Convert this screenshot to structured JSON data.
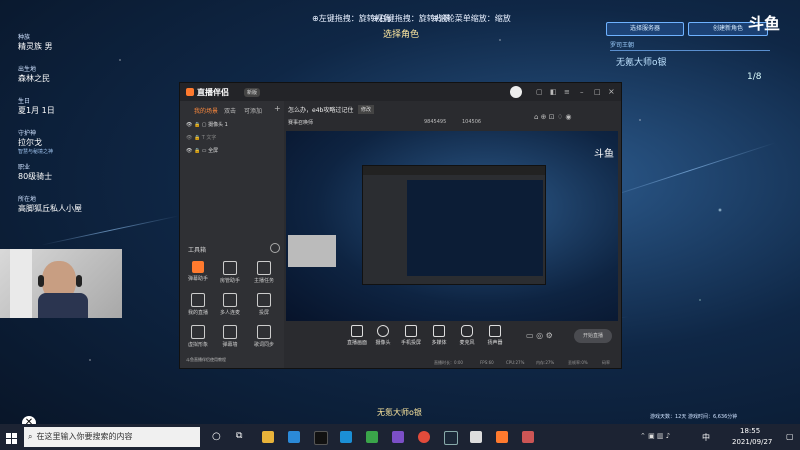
{
  "game": {
    "top_hints": [
      "⊕左键拖拽：旋转视角",
      "⊕右键拖拽：旋转背景",
      "⊕滚轮菜单缩放：缩放"
    ],
    "select_role": "选择角色",
    "left_panel": [
      {
        "label": "种族",
        "value": "精灵族 男"
      },
      {
        "label": "出生地",
        "value": "森林之民"
      },
      {
        "label": "生日",
        "value": "夏1月 1日"
      },
      {
        "label": "守护神",
        "value": "拉尔戈",
        "sub": "智慧与秘境之神"
      },
      {
        "label": "职业",
        "value": "80级骑士"
      },
      {
        "label": "所在地",
        "value": "高脚狐丘私人小屋"
      }
    ],
    "right_panel": {
      "btn_select_server": "选择服务器",
      "btn_create_role": "创建新角色",
      "server_label": "罗司王朝",
      "character_name": "无氪大师o银",
      "page": "1/8"
    },
    "bottom_name": "无氪大师o银",
    "playtime": "游戏天数：12天  游戏时间：6,636分钟"
  },
  "window": {
    "app_name": "直播伴侣",
    "version_badge": "新版",
    "sidebar_tabs": [
      "我的场景",
      "双击",
      "可添加",
      "+"
    ],
    "scene_items": [
      "摄像头 1",
      "文字",
      "全屏"
    ],
    "toolbox_label": "工具箱",
    "tools": [
      "弹幕助手",
      "房管助手",
      "主播任务",
      "我的直播",
      "多人连麦",
      "投屏",
      "虚拟形象",
      "弹幕墙",
      "歌词同步",
      "斗鱼直播伴侣使用教程"
    ],
    "stream_title": "怎么办，e4b攻略过记住",
    "edit_btn": "修改",
    "category": "赛事召唤师",
    "uid": "9845495",
    "heat": "104506",
    "controls": [
      "直播画面",
      "摄像头",
      "手机投屏",
      "多媒体",
      "麦克风",
      "扬声器"
    ],
    "start_btn": "开始直播",
    "status_items": [
      "直播时长：0:00",
      "FPS:60",
      "CPU:27%",
      "内存:27%",
      "丢帧率:0%",
      "码率"
    ]
  },
  "taskbar": {
    "search_placeholder": "在这里输入你要搜索的内容",
    "time": "18:55",
    "date": "2021/09/27",
    "ime": "中"
  },
  "watermark": "斗鱼",
  "colors": {
    "accent": "#4aa3ff",
    "orange": "#ff7a2e",
    "taskbar": "#1c2333",
    "window": "#2a2b2f"
  }
}
